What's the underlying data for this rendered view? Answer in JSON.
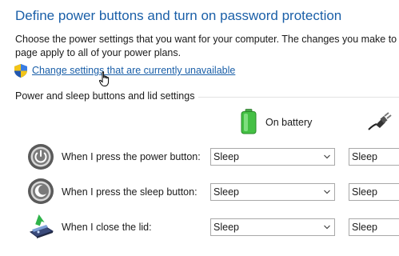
{
  "header": {
    "title": "Define power buttons and turn on password protection",
    "description": "Choose the power settings that you want for your computer. The changes you make to the settings on this page apply to all of your power plans.",
    "description_line1": "Choose the power settings that you want for your computer. The changes you make to",
    "description_line2": "page apply to all of your power plans."
  },
  "change_link": {
    "label": "Change settings that are currently unavailable",
    "icon": "uac-shield-icon"
  },
  "section": {
    "label": "Power and sleep buttons and lid settings"
  },
  "columns": {
    "on_battery": "On battery",
    "plugged_in_icon": "plug-icon",
    "battery_icon": "battery-icon"
  },
  "rows": [
    {
      "label": "When I press the power button:",
      "icon": "power-button-icon",
      "on_battery": "Sleep",
      "plugged_in": "Sleep"
    },
    {
      "label": "When I press the sleep button:",
      "icon": "sleep-button-icon",
      "on_battery": "Sleep",
      "plugged_in": "Sleep"
    },
    {
      "label": "When I close the lid:",
      "icon": "laptop-lid-icon",
      "on_battery": "Sleep",
      "plugged_in": "Sleep"
    }
  ],
  "colors": {
    "title": "#1a5fa8",
    "link": "#1a5fa8",
    "battery_green": "#3fbf3f",
    "select_border": "#a8a8a8"
  }
}
